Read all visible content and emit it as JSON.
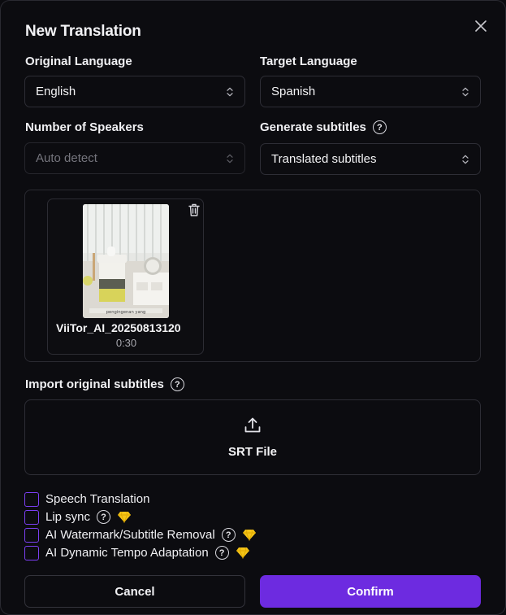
{
  "dialog": {
    "title": "New Translation",
    "close_icon": "close-icon"
  },
  "fields": {
    "original_language": {
      "label": "Original Language",
      "value": "English"
    },
    "target_language": {
      "label": "Target Language",
      "value": "Spanish"
    },
    "speakers": {
      "label": "Number of Speakers",
      "value": "Auto detect",
      "disabled": true
    },
    "subtitles": {
      "label": "Generate subtitles",
      "value": "Translated subtitles"
    }
  },
  "media": {
    "file_name": "ViiTor_AI_20250813120",
    "duration": "0:30",
    "thumbnail_caption": "pengingenan yang",
    "delete_icon": "trash-icon"
  },
  "import": {
    "label": "Import original subtitles",
    "upload_label": "SRT File",
    "upload_icon": "upload-icon"
  },
  "options": [
    {
      "label": "Speech Translation",
      "help": false,
      "premium": false,
      "checked": false
    },
    {
      "label": "Lip sync",
      "help": true,
      "premium": true,
      "checked": false
    },
    {
      "label": "AI Watermark/Subtitle Removal",
      "help": true,
      "premium": true,
      "checked": false
    },
    {
      "label": "AI Dynamic Tempo Adaptation",
      "help": true,
      "premium": true,
      "checked": false
    }
  ],
  "help_glyph": "?",
  "buttons": {
    "cancel": "Cancel",
    "confirm": "Confirm"
  },
  "colors": {
    "accent": "#6d2be0",
    "checkbox_border": "#7b3ff2",
    "premium_gem": "#f5c518"
  }
}
